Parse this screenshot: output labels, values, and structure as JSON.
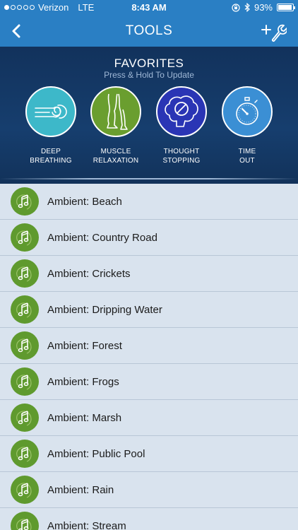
{
  "status_bar": {
    "carrier": "Verizon",
    "network": "LTE",
    "time": "8:43 AM",
    "battery": "93%",
    "battery_level": 0.93,
    "icons": [
      "orientation-lock-icon",
      "bluetooth-icon"
    ]
  },
  "nav": {
    "title": "TOOLS",
    "back_icon": "chevron-left-icon",
    "add_icon": "add-tool-icon"
  },
  "favorites": {
    "title": "FAVORITES",
    "subtitle": "Press & Hold To Update",
    "items": [
      {
        "line1": "DEEP",
        "line2": "BREATHING",
        "icon": "breathing-icon",
        "color": "#3db8c9"
      },
      {
        "line1": "MUSCLE",
        "line2": "RELAXATION",
        "icon": "leg-icon",
        "color": "#6a9e2f"
      },
      {
        "line1": "THOUGHT",
        "line2": "STOPPING",
        "icon": "brain-stop-icon",
        "color": "#2a35b5"
      },
      {
        "line1": "TIME",
        "line2": "OUT",
        "icon": "stopwatch-icon",
        "color": "#3b8fd4"
      }
    ]
  },
  "list": {
    "icon": "music-notes-icon",
    "icon_color": "#5f9a2e",
    "items": [
      "Ambient: Beach",
      "Ambient: Country Road",
      "Ambient: Crickets",
      "Ambient: Dripping Water",
      "Ambient: Forest",
      "Ambient: Frogs",
      "Ambient: Marsh",
      "Ambient: Public Pool",
      "Ambient: Rain",
      "Ambient: Stream"
    ]
  }
}
